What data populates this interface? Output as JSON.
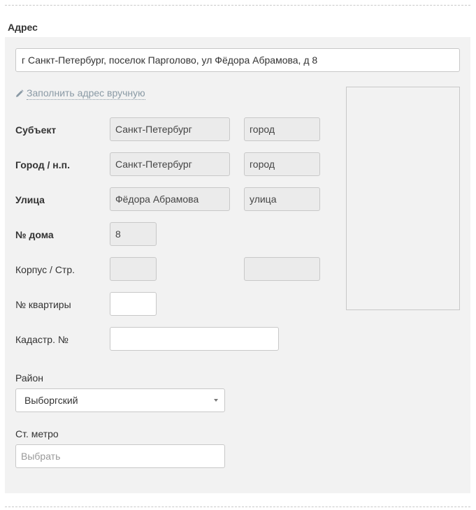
{
  "section": {
    "title": "Адрес"
  },
  "address": {
    "full_value": "г Санкт-Петербург, поселок Парголово, ул Фёдора Абрамова, д 8",
    "manual_link": "Заполнить адрес вручную",
    "rows": [
      {
        "label": "Субъект",
        "value": "Санкт-Петербург",
        "type": "город"
      },
      {
        "label": "Город / н.п.",
        "value": "Санкт-Петербург",
        "type": "город"
      },
      {
        "label": "Улица",
        "value": "Фёдора Абрамова",
        "type": "улица"
      },
      {
        "label": "№ дома",
        "value": "8"
      },
      {
        "label": "Корпус / Стр.",
        "value": "",
        "type": ""
      },
      {
        "label": "№ квартиры",
        "value": ""
      },
      {
        "label": "Кадастр. №",
        "value": ""
      }
    ]
  },
  "district": {
    "label": "Район",
    "selected": "Выборгский"
  },
  "metro": {
    "label": "Ст. метро",
    "placeholder": "Выбрать"
  },
  "icons": {
    "manual_link": "pencil-icon",
    "select_caret": "chevron-down-icon"
  },
  "colors": {
    "panel_bg": "#f2f2f2",
    "readonly_field_bg": "#ebebeb",
    "link_color": "#8a9aa5"
  }
}
